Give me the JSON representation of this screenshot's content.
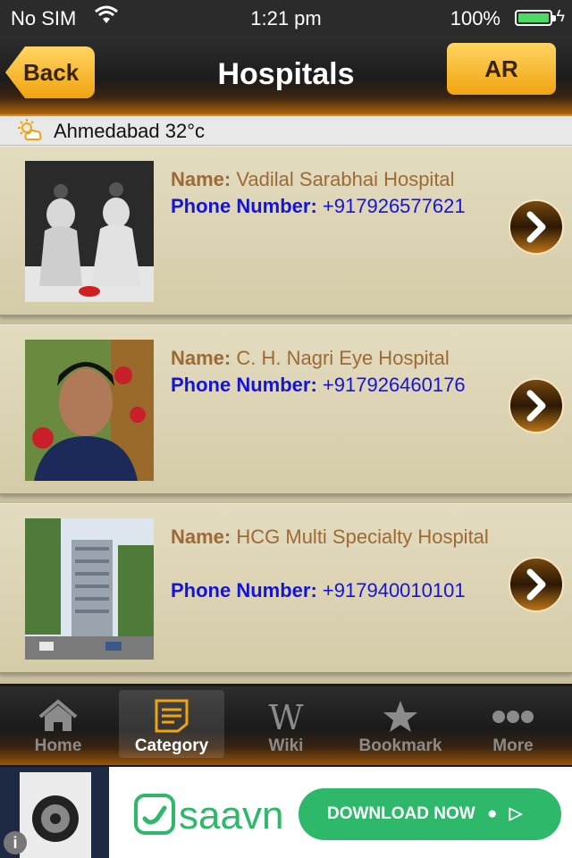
{
  "status_bar": {
    "carrier": "No SIM",
    "time": "1:21 pm",
    "battery": "100%"
  },
  "nav": {
    "title": "Hospitals",
    "back_label": "Back",
    "ar_label": "AR"
  },
  "weather": {
    "text": "Ahmedabad 32°c"
  },
  "hospitals": [
    {
      "name_label": "Name:",
      "name": "Vadilal Sarabhai Hospital",
      "phone_label": "Phone Number:",
      "phone": "+917926577621"
    },
    {
      "name_label": "Name:",
      "name": "C. H. Nagri Eye Hospital",
      "phone_label": "Phone Number:",
      "phone": "+917926460176"
    },
    {
      "name_label": "Name:",
      "name": "HCG Multi Specialty Hospital",
      "phone_label": "Phone Number:",
      "phone": "+917940010101"
    }
  ],
  "tabs": [
    {
      "label": "Home",
      "icon": "home-icon",
      "active": false
    },
    {
      "label": "Category",
      "icon": "category-icon",
      "active": true
    },
    {
      "label": "Wiki",
      "icon": "wiki-icon",
      "active": false
    },
    {
      "label": "Bookmark",
      "icon": "star-icon",
      "active": false
    },
    {
      "label": "More",
      "icon": "more-icon",
      "active": false
    }
  ],
  "ad": {
    "brand": "saavn",
    "cta": "DOWNLOAD NOW"
  },
  "colors": {
    "accent": "#f0a411",
    "name_text": "#9c6a35",
    "phone_text": "#1414d8",
    "saavn_green": "#2eb86a"
  }
}
